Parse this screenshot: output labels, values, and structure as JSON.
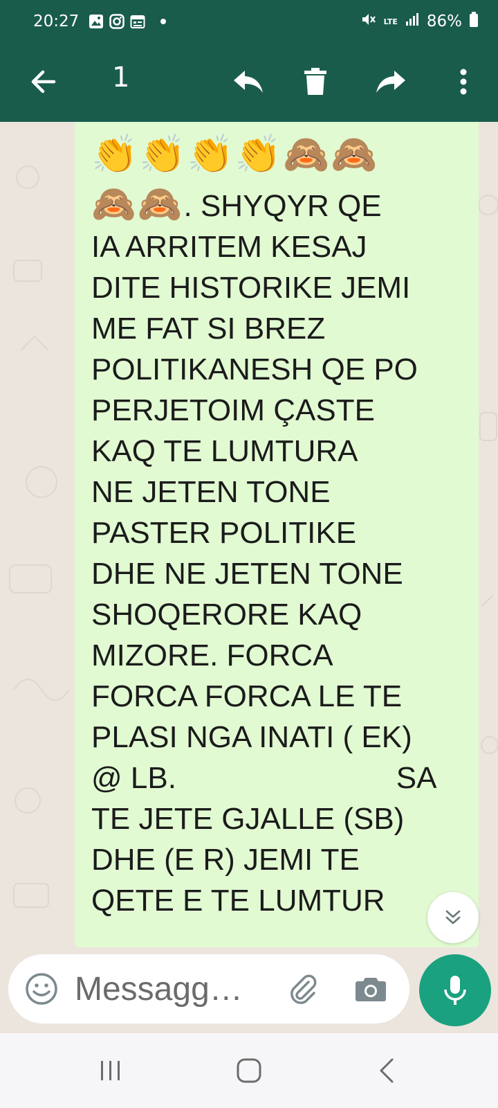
{
  "status_bar": {
    "time": "20:27",
    "network": "LTE",
    "battery": "86%",
    "icons": [
      "gallery-icon",
      "instagram-icon",
      "calendar-icon",
      "mute-icon",
      "signal-icon",
      "battery-icon"
    ]
  },
  "toolbar": {
    "selected_count": "1",
    "actions": [
      "back-arrow-icon",
      "reply-icon",
      "delete-icon",
      "forward-icon",
      "more-vert-icon"
    ]
  },
  "message": {
    "emoji_line_1": "👏👏👏👏🙈🙈",
    "emoji_line_2": "🙈🙈",
    "lines": [
      ". SHYQYR QE",
      "IA ARRITEM KESAJ",
      "DITE HISTORIKE JEMI",
      "ME FAT SI BREZ",
      "POLITIKANESH QE PO",
      "PERJETOIM ÇASTE",
      "KAQ TE LUMTURA",
      "NE JETEN TONE",
      "PASTER POLITIKE",
      "DHE NE JETEN TONE",
      "SHOQERORE KAQ",
      "MIZORE. FORCA",
      "FORCA FORCA LE TE",
      "PLASI NGA INATI ( EK)",
      "@ LB.                          SA",
      "TE JETE GJALLE (SB)",
      "DHE (E R) JEMI TE",
      "QETE E TE LUMTUR"
    ]
  },
  "composer": {
    "placeholder": "Messagg…"
  },
  "colors": {
    "header": "#1a5c4c",
    "bubble": "#e1fad2",
    "chat_bg": "#ece5dd",
    "mic": "#1aa17f"
  }
}
